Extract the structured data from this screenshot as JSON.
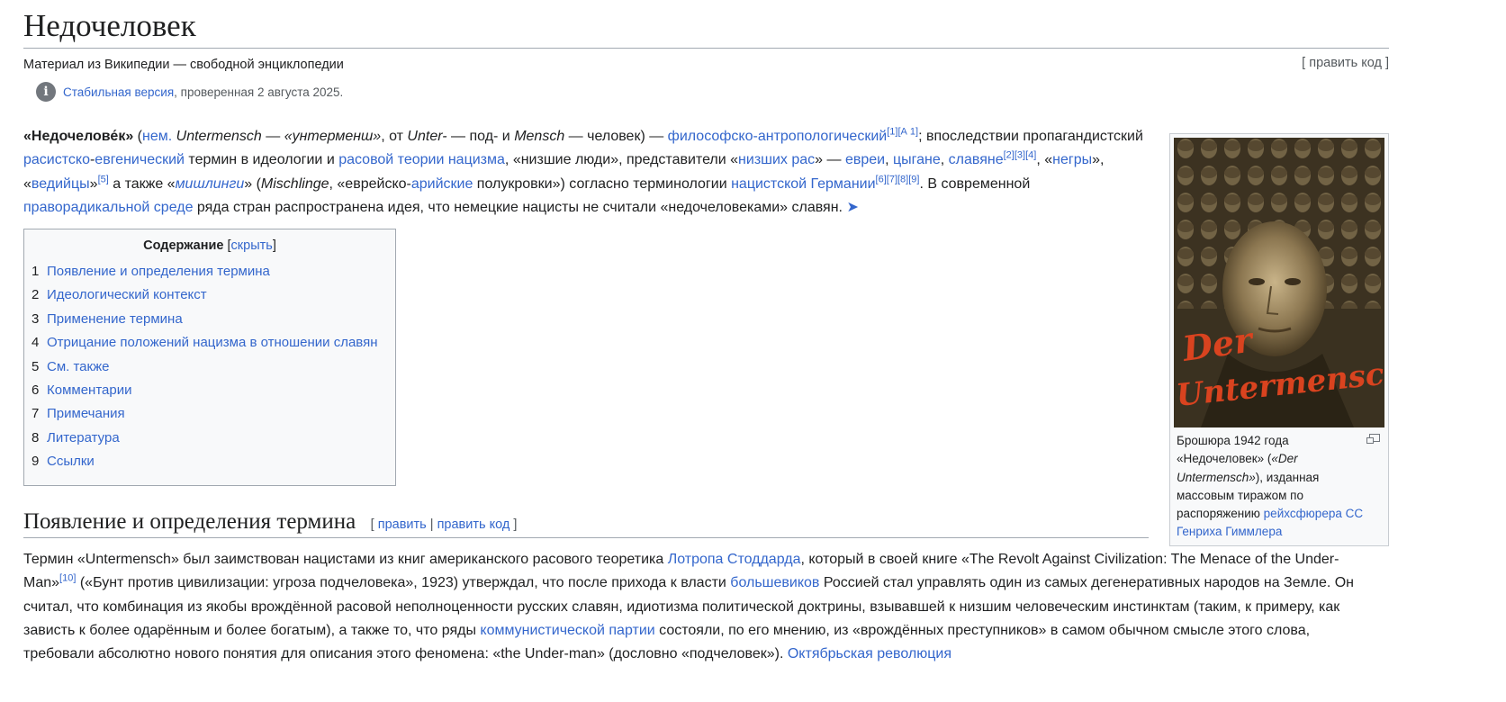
{
  "article": {
    "title": "Недочеловек",
    "from_wiki": "Материал из Википедии — свободной энциклопедии",
    "edit_code": "[ править код ]",
    "stable_link": "Стабильная версия",
    "stable_rest": ", проверенная 2 августа 2025."
  },
  "lead": {
    "t1": "«Недочелове́к»",
    "t2": " (",
    "l_nem": "нем.",
    "t3": " ",
    "i_untermensch": "Untermensch",
    "t4": " — ",
    "i_translit": "«унтерменш»",
    "t5": ", от ",
    "i_unter": "Unter-",
    "t6": " — под- и ",
    "i_mensch": "Mensch",
    "t7": " — человек) — ",
    "l_philos": "философско-антропологический",
    "s1": "[1]",
    "sA1": "[А 1]",
    "t8": "; впоследствии пропагандистский ",
    "l_racist": "расистско",
    "t9": "-",
    "l_eugenic": "евгенический",
    "t10": " термин в идеологии и ",
    "l_racial_theory": "расовой теории нацизма",
    "t11": ", «низшие люди», представители «",
    "l_lower_races": "низших рас",
    "t12": "» — ",
    "l_jews": "евреи",
    "t13": ", ",
    "l_gypsies": "цыгане",
    "t14": ", ",
    "l_slavs": "славяне",
    "s2": "[2]",
    "s3": "[3]",
    "s4": "[4]",
    "t15": ", «",
    "l_negros": "негры",
    "t16": "», «",
    "l_veddoids": "ведийцы",
    "t17": "»",
    "s5": "[5]",
    "t18": " а также «",
    "l_mischlinge": "мишлинги",
    "t19": "» (",
    "i_mischlinge": "Mischlinge",
    "t20": ", «еврейско-",
    "l_aryan": "арийские",
    "t21": " полукровки») согласно терминологии ",
    "l_nazi_germany": "нацистской Германии",
    "s6": "[6]",
    "s7": "[7]",
    "s8": "[8]",
    "s9": "[9]",
    "t22": ". В современной ",
    "l_far_right": "праворадикальной среде",
    "t23": " ряда стран распространена идея, что немецкие нацисты не считали «недочеловеками» славян. ",
    "arrow": "➤"
  },
  "toc": {
    "title": "Содержание",
    "hide": "скрыть",
    "items": [
      {
        "num": "1",
        "label": "Появление и определения термина"
      },
      {
        "num": "2",
        "label": "Идеологический контекст"
      },
      {
        "num": "3",
        "label": "Применение термина"
      },
      {
        "num": "4",
        "label": "Отрицание положений нацизма в отношении славян"
      },
      {
        "num": "5",
        "label": "См. также"
      },
      {
        "num": "6",
        "label": "Комментарии"
      },
      {
        "num": "7",
        "label": "Примечания"
      },
      {
        "num": "8",
        "label": "Литература"
      },
      {
        "num": "9",
        "label": "Ссылки"
      }
    ]
  },
  "section1": {
    "heading": "Появление и определения термина",
    "edit": "править",
    "sep": "|",
    "edit_code": "править код",
    "p1": "Термин «Untermensch» был заимствован нацистами из книг американского расового теоретика ",
    "l_stoddard": "Лотропа Стоддарда",
    "p2": ", который в своей книге «The Revolt Against Civilization: The Menace of the Under-Man»",
    "s10": "[10]",
    "p3": " («Бунт против цивилизации: угроза подчеловека», 1923) утверждал, что после прихода к власти ",
    "l_bolsheviks": "большевиков",
    "p4": " Россией стал управлять один из самых дегенеративных народов на Земле. Он считал, что комбинация из якобы врождённой расовой неполноценности русских славян, идиотизма политической доктрины, взывавшей к низшим человеческим инстинктам (таким, к примеру, как зависть к более одарённым и более богатым), а также то, что ряды ",
    "l_communist": "коммунистической партии",
    "p5": " состояли, по его мнению, из «врождённых преступников» в самом обычном смысле этого слова, требовали абсолютно нового понятия для описания этого феномена: «the Under-man» (дословно «подчеловек»). ",
    "l_october": "Октябрьская революция"
  },
  "figure": {
    "poster_text_1": "Der",
    "poster_text_2": "Untermensch",
    "cap1": "Брошюра 1942 года «Недочеловек» (",
    "cap_i": "«Der Untermensch»",
    "cap2": "), изданная массовым тиражом по распоряжению ",
    "cap_link": "рейхсфюрера СС Генриха Гиммлера"
  },
  "colors": {
    "link": "#3366cc",
    "poster_red": "#d9431f",
    "poster_sepia": "#6b5a3a"
  }
}
